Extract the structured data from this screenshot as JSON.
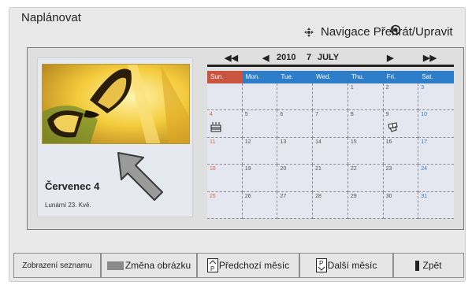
{
  "header": {
    "title": "Naplánovat",
    "hint_text": "Navigace Přehrát/Upravit",
    "hint_icons": [
      "navigate-icon",
      "ok-icon"
    ]
  },
  "calendar": {
    "year": "2010",
    "day": "7",
    "month": "JULY",
    "weekdays": [
      "Sun.",
      "Mon.",
      "Tue.",
      "Wed.",
      "Thu.",
      "Fri.",
      "Sat."
    ],
    "weeks": [
      [
        "",
        "",
        "",
        "",
        "1",
        "2",
        "3"
      ],
      [
        "4",
        "5",
        "6",
        "7",
        "8",
        "9",
        "10"
      ],
      [
        "11",
        "12",
        "13",
        "14",
        "15",
        "16",
        "17"
      ],
      [
        "18",
        "19",
        "20",
        "21",
        "22",
        "23",
        "24"
      ],
      [
        "25",
        "26",
        "27",
        "28",
        "29",
        "30",
        "31"
      ]
    ],
    "events": [
      {
        "day": "4",
        "icon": "birthday-cake-icon"
      },
      {
        "day": "9",
        "icon": "gift-icon"
      }
    ],
    "nav_icons": [
      "prev-year-icon",
      "prev-month-icon",
      "next-month-icon",
      "next-year-icon"
    ]
  },
  "photo_card": {
    "date_title": "Červenec 4",
    "lunar_text": "Lunární 23. Kvě.",
    "image": "butterfly-photo"
  },
  "toolbar": {
    "list_view": "Zobrazení seznamu",
    "change_image": "Změna obrázku",
    "prev_month": "Předchozí měsíc",
    "next_month": "Další měsíc",
    "back": "Zpět"
  },
  "colors": {
    "sunday_header": "#c9553f",
    "weekday_header": "#2e7dc8",
    "sunday_text": "#d56a4a",
    "saturday_text": "#2e7dc8"
  }
}
